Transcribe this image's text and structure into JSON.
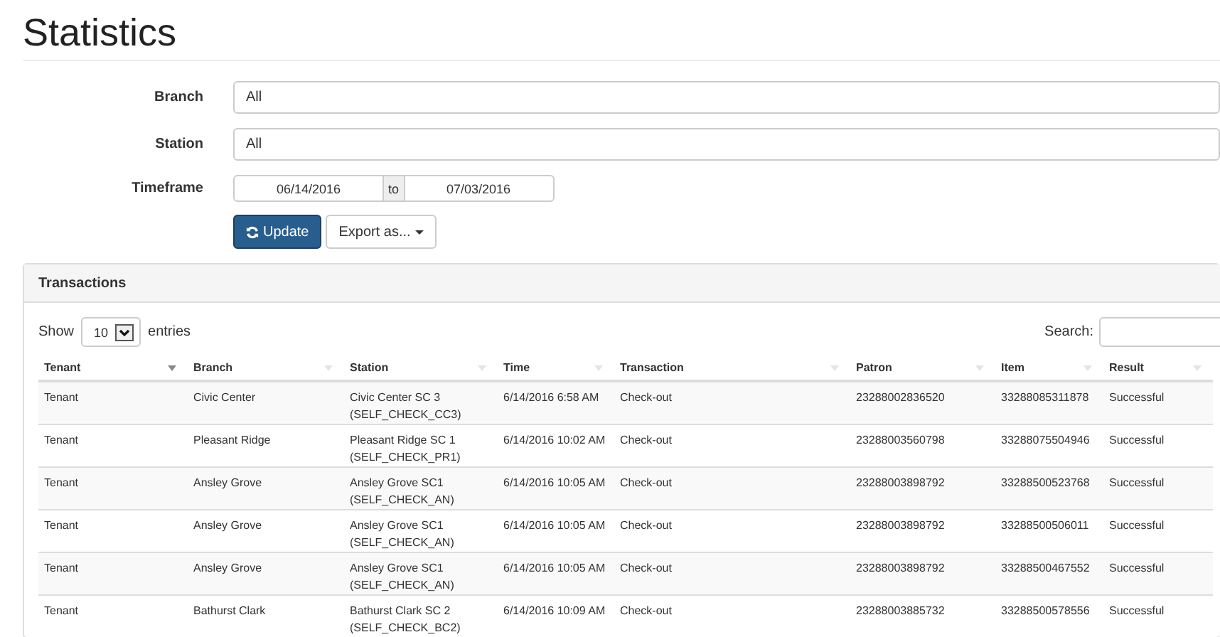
{
  "page_title": "Statistics",
  "filters": [
    {
      "label": "Branch",
      "kind": "select",
      "value": "All"
    },
    {
      "label": "Station",
      "kind": "select",
      "value": "All"
    },
    {
      "label": "Timeframe",
      "kind": "daterange",
      "from": "06/14/2016",
      "separator": "to",
      "to": "07/03/2016"
    }
  ],
  "buttons": [
    {
      "label": "Update",
      "kind": "primary"
    },
    {
      "label": "Export as...",
      "kind": "dropdown"
    }
  ],
  "panel": {
    "title": "Transactions",
    "length": {
      "before": "Show",
      "value": "10",
      "after": "entries"
    },
    "search": {
      "label": "Search:"
    },
    "table": {
      "columns": [
        {
          "label": "Tenant",
          "sorted": true
        },
        {
          "label": "Branch",
          "sorted": false
        },
        {
          "label": "Station",
          "sorted": false
        },
        {
          "label": "Time",
          "sorted": false
        },
        {
          "label": "Transaction",
          "sorted": false
        },
        {
          "label": "Patron",
          "sorted": false
        },
        {
          "label": "Item",
          "sorted": false
        },
        {
          "label": "Result",
          "sorted": false
        }
      ],
      "rows": [
        [
          "Tenant",
          "Civic Center",
          "Civic Center SC 3 (SELF_CHECK_CC3)",
          "6/14/2016 6:58 AM",
          "Check-out",
          "23288002836520",
          "33288085311878",
          "Successful"
        ],
        [
          "Tenant",
          "Pleasant Ridge",
          "Pleasant Ridge SC 1 (SELF_CHECK_PR1)",
          "6/14/2016 10:02 AM",
          "Check-out",
          "23288003560798",
          "33288075504946",
          "Successful"
        ],
        [
          "Tenant",
          "Ansley Grove",
          "Ansley Grove SC1 (SELF_CHECK_AN)",
          "6/14/2016 10:05 AM",
          "Check-out",
          "23288003898792",
          "33288500523768",
          "Successful"
        ],
        [
          "Tenant",
          "Ansley Grove",
          "Ansley Grove SC1 (SELF_CHECK_AN)",
          "6/14/2016 10:05 AM",
          "Check-out",
          "23288003898792",
          "33288500506011",
          "Successful"
        ],
        [
          "Tenant",
          "Ansley Grove",
          "Ansley Grove SC1 (SELF_CHECK_AN)",
          "6/14/2016 10:05 AM",
          "Check-out",
          "23288003898792",
          "33288500467552",
          "Successful"
        ],
        [
          "Tenant",
          "Bathurst Clark",
          "Bathurst Clark SC 2 (SELF_CHECK_BC2)",
          "6/14/2016 10:09 AM",
          "Check-out",
          "23288003885732",
          "33288500578556",
          "Successful"
        ]
      ]
    }
  }
}
